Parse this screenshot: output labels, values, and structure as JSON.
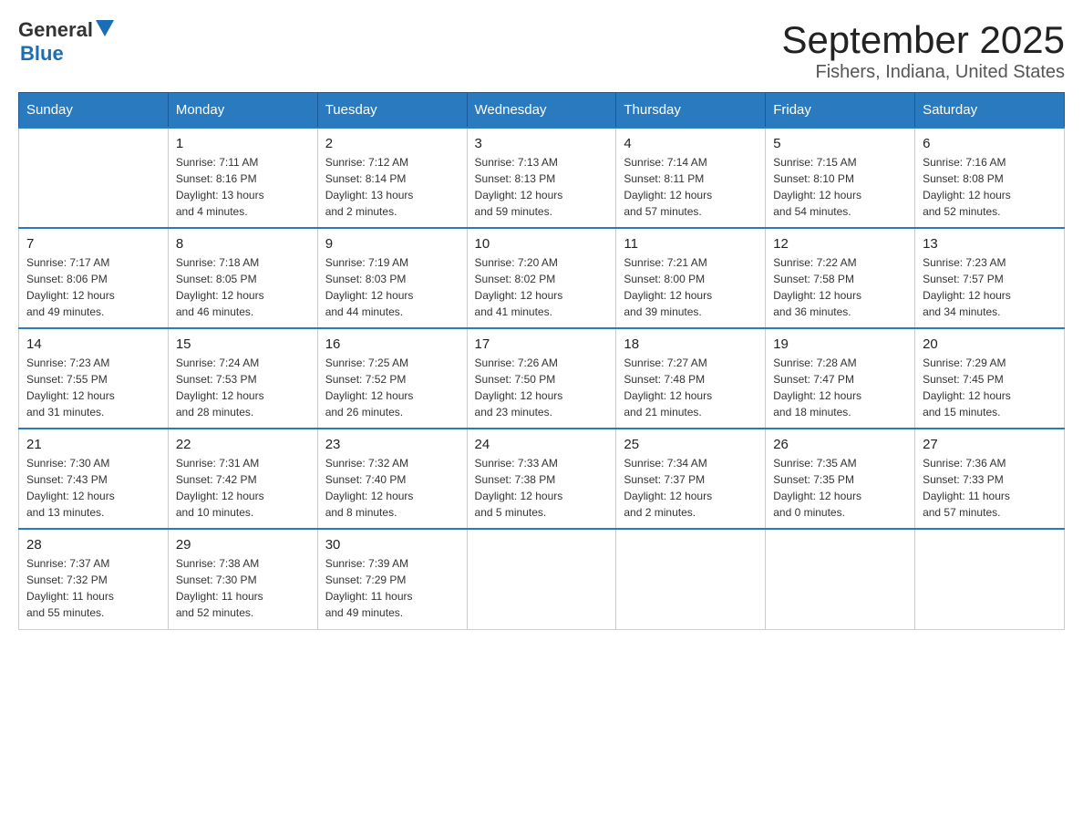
{
  "logo": {
    "general": "General",
    "blue": "Blue"
  },
  "title": "September 2025",
  "subtitle": "Fishers, Indiana, United States",
  "weekdays": [
    "Sunday",
    "Monday",
    "Tuesday",
    "Wednesday",
    "Thursday",
    "Friday",
    "Saturday"
  ],
  "weeks": [
    [
      {
        "day": "",
        "info": ""
      },
      {
        "day": "1",
        "info": "Sunrise: 7:11 AM\nSunset: 8:16 PM\nDaylight: 13 hours\nand 4 minutes."
      },
      {
        "day": "2",
        "info": "Sunrise: 7:12 AM\nSunset: 8:14 PM\nDaylight: 13 hours\nand 2 minutes."
      },
      {
        "day": "3",
        "info": "Sunrise: 7:13 AM\nSunset: 8:13 PM\nDaylight: 12 hours\nand 59 minutes."
      },
      {
        "day": "4",
        "info": "Sunrise: 7:14 AM\nSunset: 8:11 PM\nDaylight: 12 hours\nand 57 minutes."
      },
      {
        "day": "5",
        "info": "Sunrise: 7:15 AM\nSunset: 8:10 PM\nDaylight: 12 hours\nand 54 minutes."
      },
      {
        "day": "6",
        "info": "Sunrise: 7:16 AM\nSunset: 8:08 PM\nDaylight: 12 hours\nand 52 minutes."
      }
    ],
    [
      {
        "day": "7",
        "info": "Sunrise: 7:17 AM\nSunset: 8:06 PM\nDaylight: 12 hours\nand 49 minutes."
      },
      {
        "day": "8",
        "info": "Sunrise: 7:18 AM\nSunset: 8:05 PM\nDaylight: 12 hours\nand 46 minutes."
      },
      {
        "day": "9",
        "info": "Sunrise: 7:19 AM\nSunset: 8:03 PM\nDaylight: 12 hours\nand 44 minutes."
      },
      {
        "day": "10",
        "info": "Sunrise: 7:20 AM\nSunset: 8:02 PM\nDaylight: 12 hours\nand 41 minutes."
      },
      {
        "day": "11",
        "info": "Sunrise: 7:21 AM\nSunset: 8:00 PM\nDaylight: 12 hours\nand 39 minutes."
      },
      {
        "day": "12",
        "info": "Sunrise: 7:22 AM\nSunset: 7:58 PM\nDaylight: 12 hours\nand 36 minutes."
      },
      {
        "day": "13",
        "info": "Sunrise: 7:23 AM\nSunset: 7:57 PM\nDaylight: 12 hours\nand 34 minutes."
      }
    ],
    [
      {
        "day": "14",
        "info": "Sunrise: 7:23 AM\nSunset: 7:55 PM\nDaylight: 12 hours\nand 31 minutes."
      },
      {
        "day": "15",
        "info": "Sunrise: 7:24 AM\nSunset: 7:53 PM\nDaylight: 12 hours\nand 28 minutes."
      },
      {
        "day": "16",
        "info": "Sunrise: 7:25 AM\nSunset: 7:52 PM\nDaylight: 12 hours\nand 26 minutes."
      },
      {
        "day": "17",
        "info": "Sunrise: 7:26 AM\nSunset: 7:50 PM\nDaylight: 12 hours\nand 23 minutes."
      },
      {
        "day": "18",
        "info": "Sunrise: 7:27 AM\nSunset: 7:48 PM\nDaylight: 12 hours\nand 21 minutes."
      },
      {
        "day": "19",
        "info": "Sunrise: 7:28 AM\nSunset: 7:47 PM\nDaylight: 12 hours\nand 18 minutes."
      },
      {
        "day": "20",
        "info": "Sunrise: 7:29 AM\nSunset: 7:45 PM\nDaylight: 12 hours\nand 15 minutes."
      }
    ],
    [
      {
        "day": "21",
        "info": "Sunrise: 7:30 AM\nSunset: 7:43 PM\nDaylight: 12 hours\nand 13 minutes."
      },
      {
        "day": "22",
        "info": "Sunrise: 7:31 AM\nSunset: 7:42 PM\nDaylight: 12 hours\nand 10 minutes."
      },
      {
        "day": "23",
        "info": "Sunrise: 7:32 AM\nSunset: 7:40 PM\nDaylight: 12 hours\nand 8 minutes."
      },
      {
        "day": "24",
        "info": "Sunrise: 7:33 AM\nSunset: 7:38 PM\nDaylight: 12 hours\nand 5 minutes."
      },
      {
        "day": "25",
        "info": "Sunrise: 7:34 AM\nSunset: 7:37 PM\nDaylight: 12 hours\nand 2 minutes."
      },
      {
        "day": "26",
        "info": "Sunrise: 7:35 AM\nSunset: 7:35 PM\nDaylight: 12 hours\nand 0 minutes."
      },
      {
        "day": "27",
        "info": "Sunrise: 7:36 AM\nSunset: 7:33 PM\nDaylight: 11 hours\nand 57 minutes."
      }
    ],
    [
      {
        "day": "28",
        "info": "Sunrise: 7:37 AM\nSunset: 7:32 PM\nDaylight: 11 hours\nand 55 minutes."
      },
      {
        "day": "29",
        "info": "Sunrise: 7:38 AM\nSunset: 7:30 PM\nDaylight: 11 hours\nand 52 minutes."
      },
      {
        "day": "30",
        "info": "Sunrise: 7:39 AM\nSunset: 7:29 PM\nDaylight: 11 hours\nand 49 minutes."
      },
      {
        "day": "",
        "info": ""
      },
      {
        "day": "",
        "info": ""
      },
      {
        "day": "",
        "info": ""
      },
      {
        "day": "",
        "info": ""
      }
    ]
  ]
}
